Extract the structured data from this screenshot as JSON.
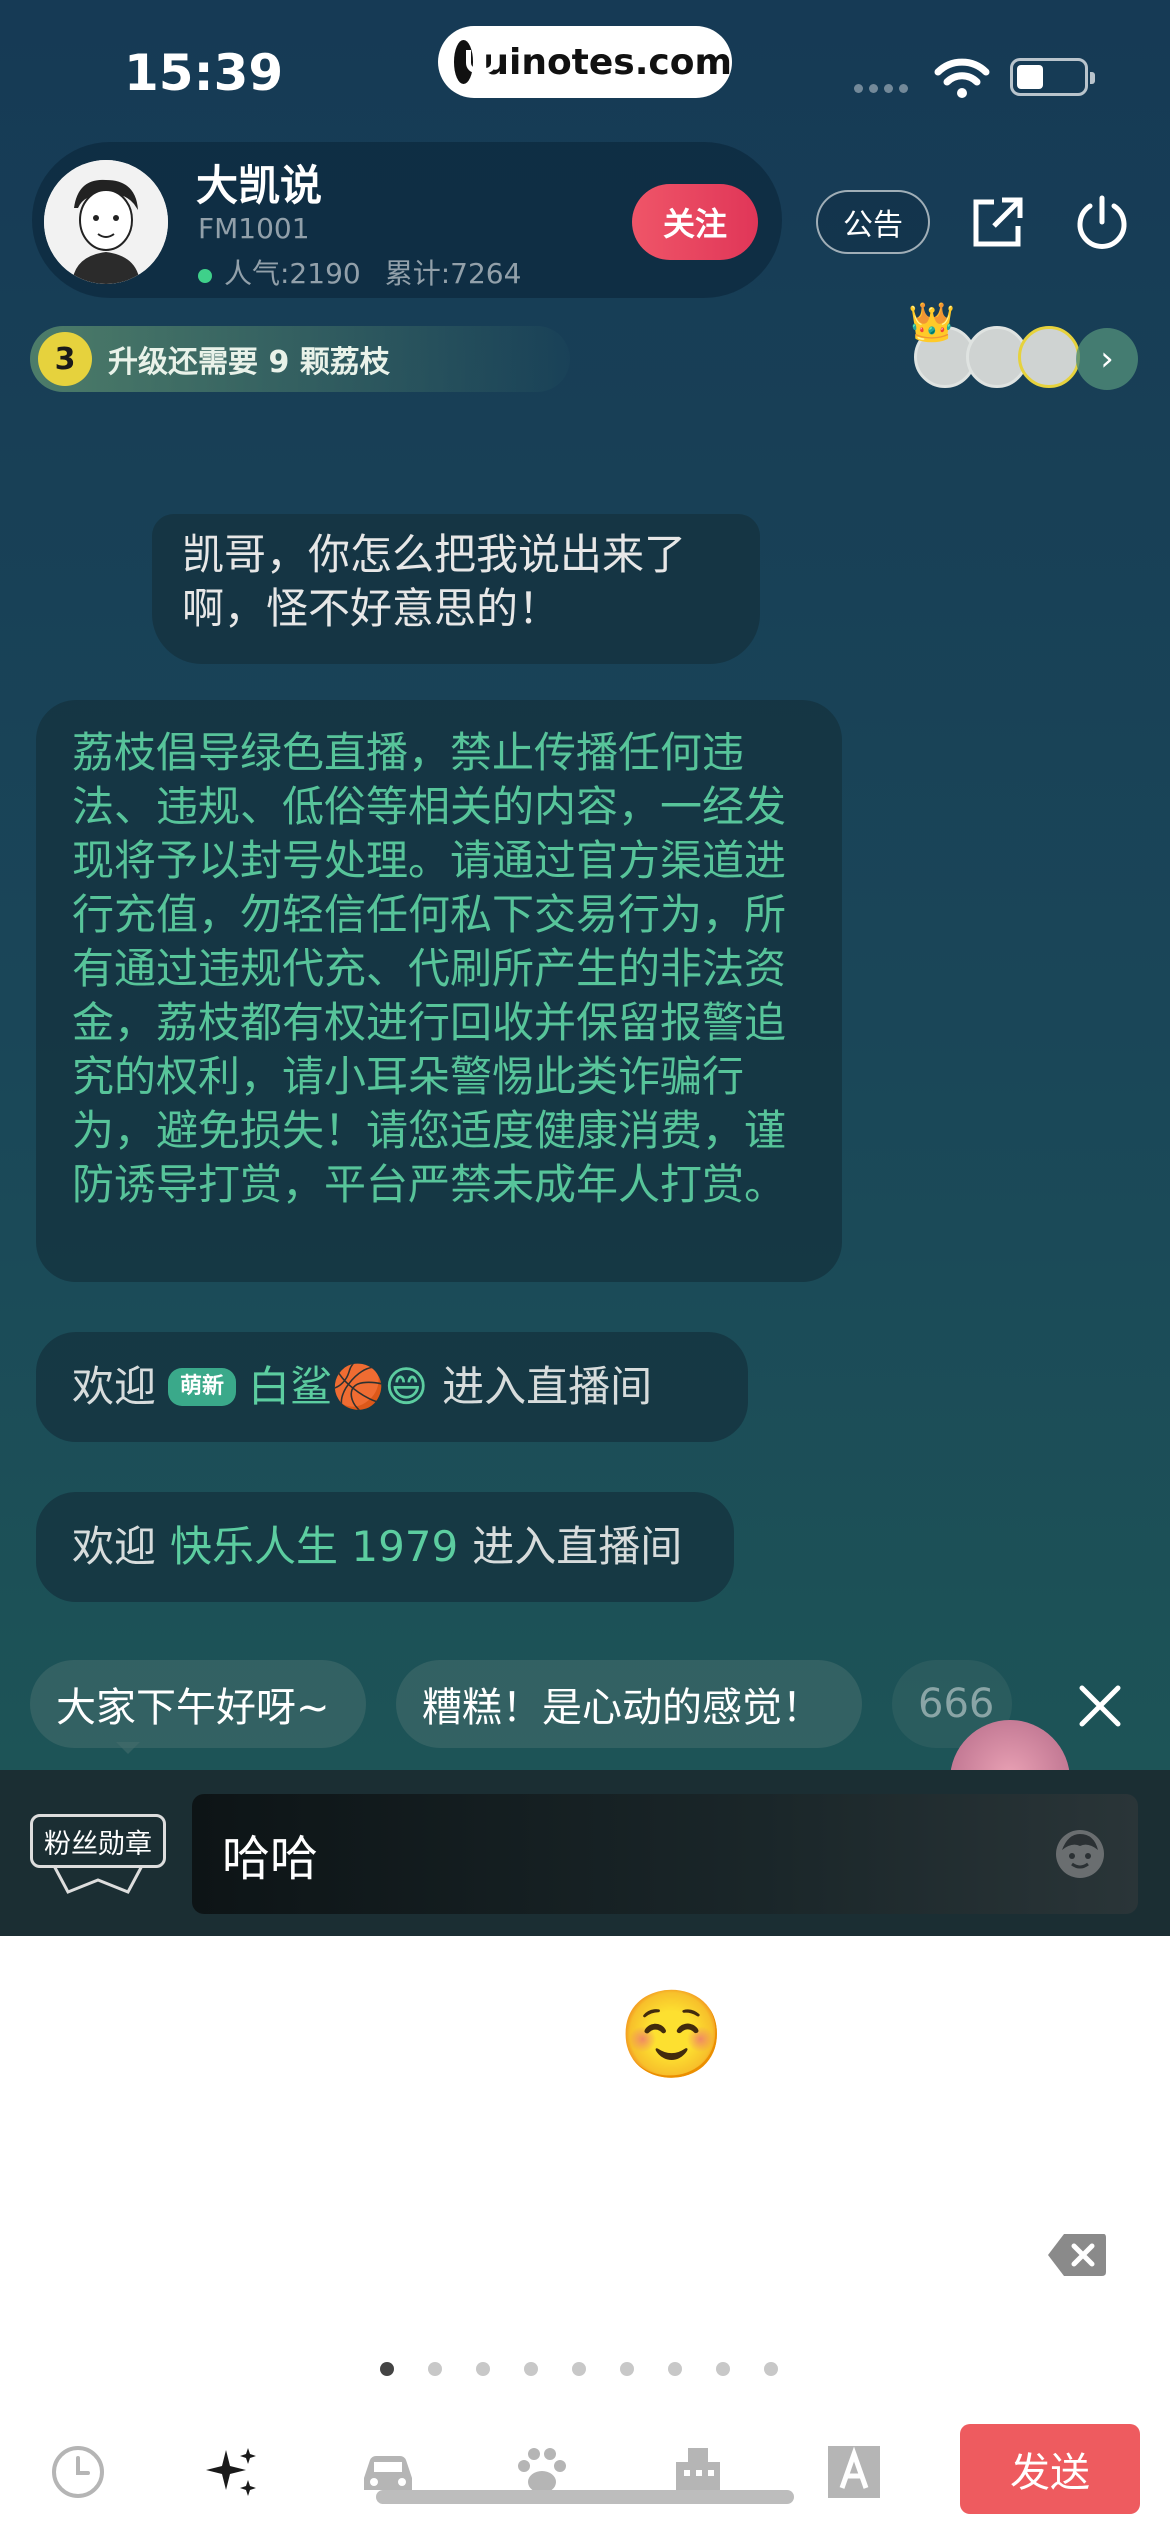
{
  "status_bar": {
    "time": "15:39",
    "url": "uinotes.com"
  },
  "host": {
    "name": "大凯说",
    "fm": "FM1001",
    "popularity": "人气:2190",
    "total": "累计:7264",
    "follow_label": "关注",
    "notice_label": "公告"
  },
  "level": {
    "number": "3",
    "text": "升级还需要 9 颗荔枝"
  },
  "chat": {
    "user_message": "凯哥，你怎么把我说出来了啊，怪不好意思的！",
    "notice": "荔枝倡导绿色直播，禁止传播任何违法、违规、低俗等相关的内容，一经发现将予以封号处理。请通过官方渠道进行充值，勿轻信任何私下交易行为，所有通过违规代充、代刷所产生的非法资金，荔枝都有权进行回收并保留报警追究的权利，请小耳朵警惕此类诈骗行为，避免损失！请您适度健康消费，谨防诱导打赏，平台严禁未成年人打赏。",
    "welcome1": {
      "prefix": "欢迎",
      "tag": "萌新",
      "user": "白鲨🏀😄",
      "suffix": "进入直播间"
    },
    "welcome2": {
      "prefix": "欢迎",
      "user": "快乐人生 1979",
      "suffix": "进入直播间"
    }
  },
  "quick_replies": [
    "大家下午好呀~",
    "糟糕！是心动的感觉！",
    "666"
  ],
  "input": {
    "medal_label": "粉丝勋章",
    "value": "哈哈"
  },
  "emojis": [
    "😄",
    "😃",
    "😀",
    "😊",
    "☺️",
    "😉",
    "😍",
    "😘",
    "😚",
    "😗",
    "😙",
    "😜",
    "😝",
    "😛",
    "😳",
    "😁",
    "😔",
    "😌",
    "😒",
    "😞",
    "😣",
    "😢",
    "😂"
  ],
  "page_dots": {
    "count": 9,
    "active": 0
  },
  "toolbar": {
    "icons": [
      "clock-icon",
      "sparkle-icon",
      "car-icon",
      "paw-icon",
      "building-icon",
      "font-icon"
    ],
    "send_label": "发送"
  },
  "colors": {
    "accent_green": "#5ccda0",
    "follow_red": "#e03658",
    "send_red": "#ee5b5f"
  }
}
